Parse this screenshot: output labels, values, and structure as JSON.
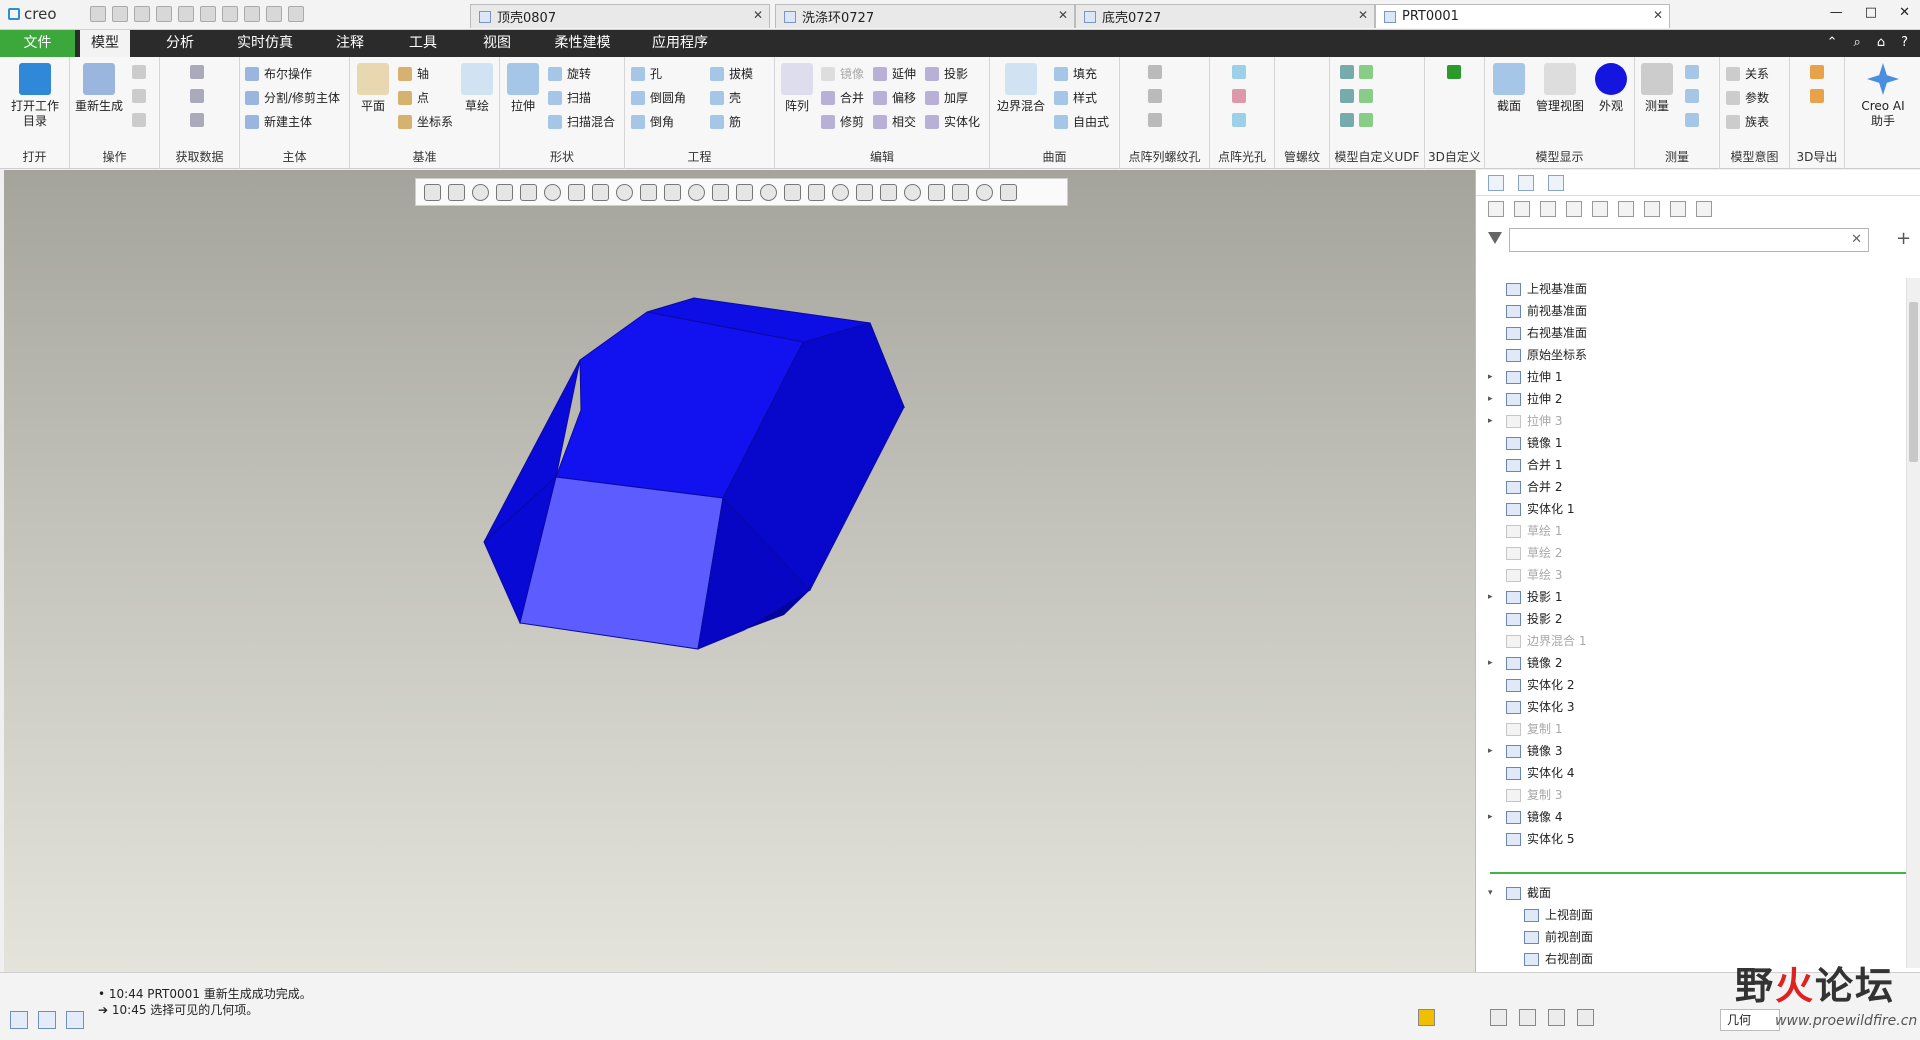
{
  "app": {
    "logo": "creo",
    "window_controls": [
      "—",
      "□",
      "✕"
    ]
  },
  "tabs": [
    {
      "label": "顶壳0807",
      "active": false
    },
    {
      "label": "洗涤环0727",
      "active": false
    },
    {
      "label": "底壳0727",
      "active": false
    },
    {
      "label": "PRT0001",
      "active": true
    }
  ],
  "menu": {
    "file": "文件",
    "model": "模型",
    "analysis": "分析",
    "simulation": "实时仿真",
    "annotate": "注释",
    "tools": "工具",
    "view": "视图",
    "flexible": "柔性建模",
    "apps": "应用程序",
    "right_icons": [
      "⌃",
      "⌕",
      "⌂",
      "?"
    ]
  },
  "ribbon": {
    "open": {
      "btn": "打开工作\n目录",
      "label": "打开"
    },
    "ops": {
      "regen": "重新生成",
      "label": "操作"
    },
    "getdata": {
      "label": "获取数据"
    },
    "body": {
      "bool": "布尔操作",
      "split": "分割/修剪主体",
      "new": "新建主体",
      "label": "主体"
    },
    "datum": {
      "plane": "平面",
      "axis": "轴",
      "point": "点",
      "csys": "坐标系",
      "sketch": "草绘",
      "label": "基准"
    },
    "shapes": {
      "extrude": "拉伸",
      "revolve": "旋转",
      "sweep": "扫描",
      "blend": "扫描混合",
      "label": "形状"
    },
    "eng": {
      "hole": "孔",
      "round": "倒圆角",
      "chamfer": "倒角",
      "draft": "拔模",
      "shell": "壳",
      "rib": "筋",
      "label": "工程"
    },
    "edit": {
      "pattern": "阵列",
      "mirror": "镜像",
      "extend": "延伸",
      "project": "投影",
      "merge": "合并",
      "offset": "偏移",
      "thicken": "加厚",
      "trim": "修剪",
      "intersect": "相交",
      "solidify": "实体化",
      "label": "编辑"
    },
    "surface": {
      "boundary": "边界混合",
      "fill": "填充",
      "style": "样式",
      "freestyle": "自由式",
      "label": "曲面"
    },
    "pointthread": {
      "label": "点阵列螺纹孔"
    },
    "pointhole": {
      "label": "点阵光孔"
    },
    "pipe": {
      "label": "管螺纹"
    },
    "udf": {
      "label": "模型自定义UDF"
    },
    "custom3d": {
      "label": "3D自定义"
    },
    "display": {
      "section": "截面",
      "manage": "管理视图",
      "appearance": "外观",
      "label": "模型显示"
    },
    "measure": {
      "btn": "测量",
      "label": "测量"
    },
    "intent": {
      "relations": "关系",
      "params": "参数",
      "family": "族表",
      "label": "模型意图"
    },
    "export": {
      "label": "3D导出"
    },
    "ai": {
      "btn": "Creo AI\n助手"
    }
  },
  "tree": [
    {
      "label": "上视基准面",
      "icon": "datum-plane-icon",
      "state": "normal",
      "exp": false
    },
    {
      "label": "前视基准面",
      "icon": "datum-plane-icon",
      "state": "normal",
      "exp": false
    },
    {
      "label": "右视基准面",
      "icon": "datum-plane-icon",
      "state": "normal",
      "exp": false
    },
    {
      "label": "原始坐标系",
      "icon": "csys-icon",
      "state": "normal",
      "exp": false
    },
    {
      "label": "拉伸 1",
      "icon": "extrude-icon",
      "state": "normal",
      "exp": true
    },
    {
      "label": "拉伸 2",
      "icon": "extrude-icon",
      "state": "normal",
      "exp": true
    },
    {
      "label": "拉伸 3",
      "icon": "extrude-icon",
      "state": "suppressed",
      "exp": true
    },
    {
      "label": "镜像 1",
      "icon": "mirror-icon",
      "state": "normal",
      "exp": false
    },
    {
      "label": "合并 1",
      "icon": "merge-icon",
      "state": "normal",
      "exp": false
    },
    {
      "label": "合并 2",
      "icon": "merge-icon",
      "state": "normal",
      "exp": false
    },
    {
      "label": "实体化 1",
      "icon": "solidify-icon",
      "state": "normal",
      "exp": false
    },
    {
      "label": "草绘 1",
      "icon": "sketch-icon",
      "state": "suppressed",
      "exp": false
    },
    {
      "label": "草绘 2",
      "icon": "sketch-icon",
      "state": "suppressed",
      "exp": false
    },
    {
      "label": "草绘 3",
      "icon": "sketch-icon",
      "state": "suppressed",
      "exp": false
    },
    {
      "label": "投影 1",
      "icon": "project-icon",
      "state": "normal",
      "exp": true
    },
    {
      "label": "投影 2",
      "icon": "project-icon",
      "state": "normal",
      "exp": false
    },
    {
      "label": "边界混合 1",
      "icon": "boundary-icon",
      "state": "suppressed",
      "exp": false
    },
    {
      "label": "镜像 2",
      "icon": "mirror-icon",
      "state": "normal",
      "exp": true
    },
    {
      "label": "实体化 2",
      "icon": "solidify-icon",
      "state": "normal",
      "exp": false
    },
    {
      "label": "实体化 3",
      "icon": "solidify-icon",
      "state": "normal",
      "exp": false
    },
    {
      "label": "复制 1",
      "icon": "copy-icon",
      "state": "suppressed",
      "exp": false
    },
    {
      "label": "镜像 3",
      "icon": "mirror-icon",
      "state": "normal",
      "exp": true
    },
    {
      "label": "实体化 4",
      "icon": "solidify-icon",
      "state": "normal",
      "exp": false
    },
    {
      "label": "复制 3",
      "icon": "copy-icon",
      "state": "suppressed",
      "exp": false
    },
    {
      "label": "镜像 4",
      "icon": "mirror-icon",
      "state": "normal",
      "exp": true
    },
    {
      "label": "实体化 5",
      "icon": "solidify-icon",
      "state": "normal",
      "exp": false
    }
  ],
  "sections": {
    "root": "截面",
    "items": [
      "上视剖面",
      "前视剖面",
      "右视剖面"
    ]
  },
  "status": {
    "msg1": "10:44 PRT0001 重新生成成功完成。",
    "msg2": "10:45 选择可见的几何项。",
    "geometry_filter": "几何"
  },
  "watermark": {
    "text1": "野",
    "text2": "火",
    "text3": "论坛",
    "url": "www.proewildfire.cn"
  },
  "colors": {
    "model_top": "#0e0ef0",
    "model_front": "#5a5aff",
    "model_side": "#0606c8",
    "accent_green": "#3ca83c"
  }
}
